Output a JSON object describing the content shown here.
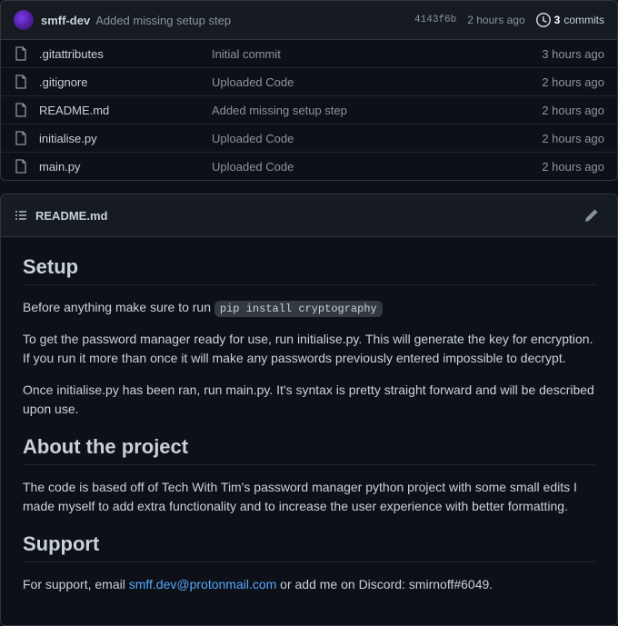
{
  "commitBar": {
    "author": "smff-dev",
    "message": "Added missing setup step",
    "sha": "4143f6b",
    "time": "2 hours ago",
    "commitsCount": "3",
    "commitsLabel": "commits"
  },
  "files": [
    {
      "name": ".gitattributes",
      "msg": "Initial commit",
      "time": "3 hours ago"
    },
    {
      "name": ".gitignore",
      "msg": "Uploaded Code",
      "time": "2 hours ago"
    },
    {
      "name": "README.md",
      "msg": "Added missing setup step",
      "time": "2 hours ago"
    },
    {
      "name": "initialise.py",
      "msg": "Uploaded Code",
      "time": "2 hours ago"
    },
    {
      "name": "main.py",
      "msg": "Uploaded Code",
      "time": "2 hours ago"
    }
  ],
  "readmeHeader": {
    "filename": "README.md"
  },
  "readme": {
    "h1": "Setup",
    "p1a": "Before anything make sure to run ",
    "code1": "pip install cryptography",
    "p2": "To get the password manager ready for use, run initialise.py. This will generate the key for encryption. If you run it more than once it will make any passwords previously entered impossible to decrypt.",
    "p3": "Once initialise.py has been ran, run main.py. It's syntax is pretty straight forward and will be described upon use.",
    "h2": "About the project",
    "p4": "The code is based off of Tech With Tim's password manager python project with some small edits I made myself to add extra functionality and to increase the user experience with better formatting.",
    "h3": "Support",
    "p5a": "For support, email ",
    "email": "smff.dev@protonmail.com",
    "p5b": " or add me on Discord: smirnoff#6049."
  }
}
